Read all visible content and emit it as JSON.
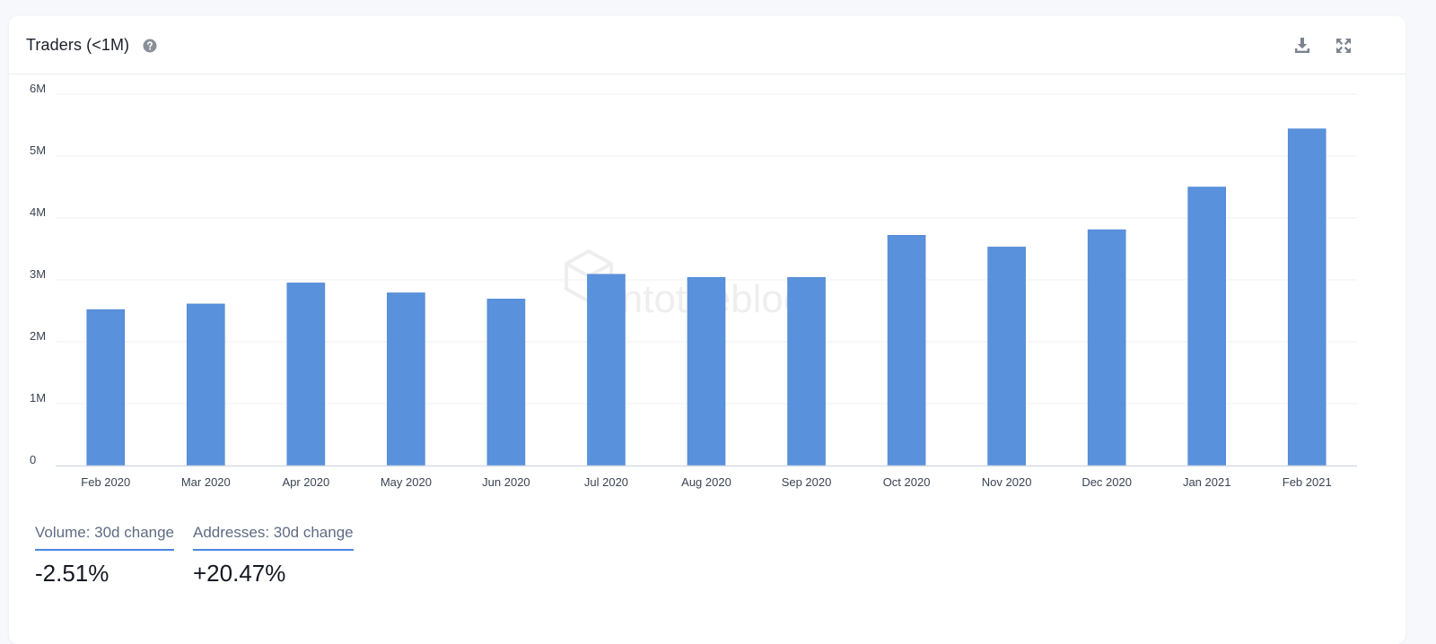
{
  "header": {
    "title": "Traders (<1M)",
    "help_icon": "question-circle-icon",
    "download_icon": "download-icon",
    "expand_icon": "expand-icon"
  },
  "watermark": "intotheblock",
  "colors": {
    "bar": "#5a91dc",
    "grid": "#eef0f5",
    "axis": "#d6dae3",
    "tick_text": "#3b4252",
    "accent": "#4a86df"
  },
  "chart_data": {
    "type": "bar",
    "title": "Traders (<1M)",
    "xlabel": "",
    "ylabel": "",
    "categories": [
      "Feb 2020",
      "Mar 2020",
      "Apr 2020",
      "May 2020",
      "Jun 2020",
      "Jul 2020",
      "Aug 2020",
      "Sep 2020",
      "Oct 2020",
      "Nov 2020",
      "Dec 2020",
      "Jan 2021",
      "Feb 2021"
    ],
    "values": [
      2520000,
      2610000,
      2950000,
      2790000,
      2690000,
      3090000,
      3040000,
      3040000,
      3720000,
      3530000,
      3810000,
      4500000,
      5440000
    ],
    "ylim": [
      0,
      6000000
    ],
    "yticks": [
      0,
      1000000,
      2000000,
      3000000,
      4000000,
      5000000,
      6000000
    ],
    "ytick_labels": [
      "0",
      "1M",
      "2M",
      "3M",
      "4M",
      "5M",
      "6M"
    ],
    "grid": true,
    "legend": "none"
  },
  "stats": [
    {
      "label": "Volume: 30d change",
      "value": "-2.51%"
    },
    {
      "label": "Addresses: 30d change",
      "value": "+20.47%"
    }
  ]
}
